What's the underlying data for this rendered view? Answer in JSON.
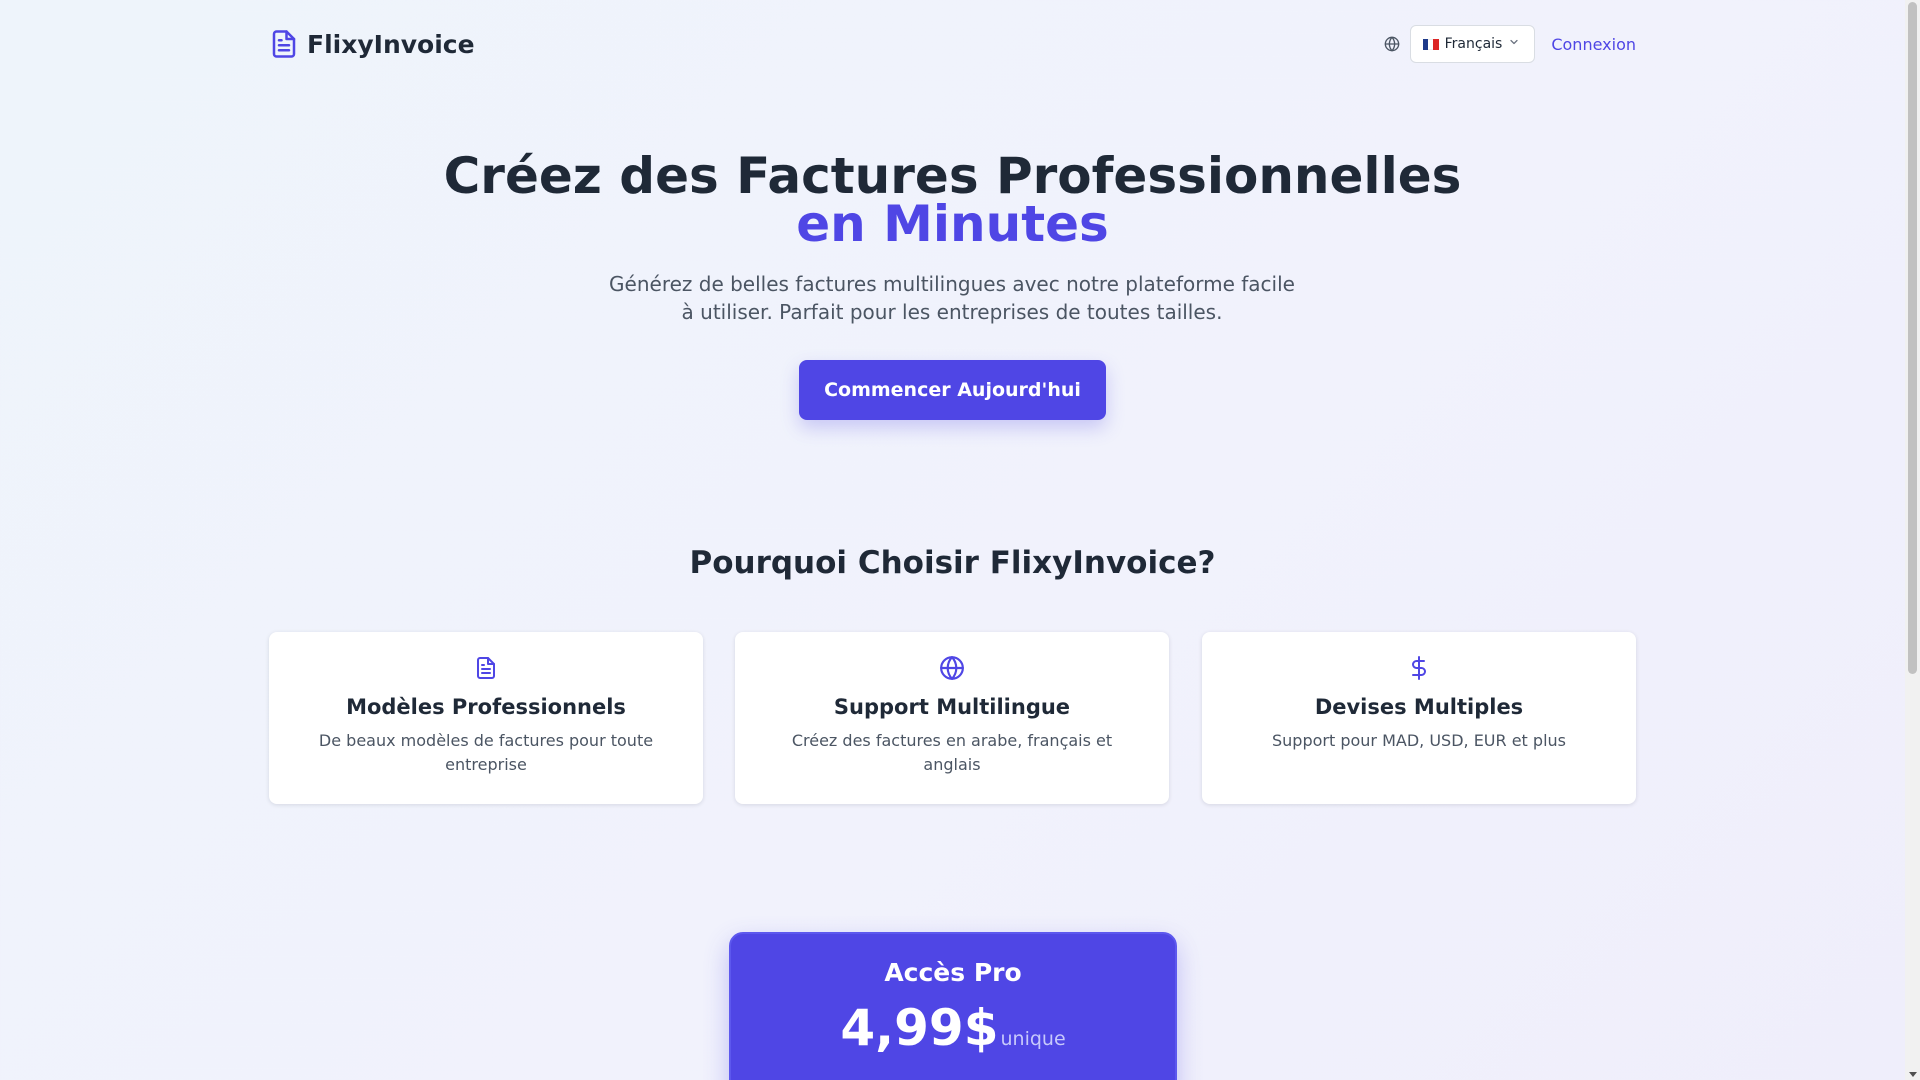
{
  "header": {
    "brand_name": "FlixyInvoice",
    "language": "Français",
    "login_label": "Connexion"
  },
  "hero": {
    "title_line1": "Créez des Factures Professionnelles",
    "title_line2": "en Minutes",
    "subtitle": "Générez de belles factures multilingues avec notre plateforme facile à utiliser. Parfait pour les entreprises de toutes tailles.",
    "cta_label": "Commencer Aujourd'hui"
  },
  "features": {
    "title": "Pourquoi Choisir FlixyInvoice?",
    "items": [
      {
        "icon": "document-icon",
        "title": "Modèles Professionnels",
        "description": "De beaux modèles de factures pour toute entreprise"
      },
      {
        "icon": "globe-icon",
        "title": "Support Multilingue",
        "description": "Créez des factures en arabe, français et anglais"
      },
      {
        "icon": "dollar-icon",
        "title": "Devises Multiples",
        "description": "Support pour MAD, USD, EUR et plus"
      }
    ]
  },
  "pricing": {
    "plan_name": "Accès Pro",
    "price": "4,99$",
    "price_note": "unique"
  },
  "colors": {
    "accent": "#4f46e5",
    "text_dark": "#1f2937",
    "text_muted": "#4b5563",
    "background": "#eef2fb"
  }
}
